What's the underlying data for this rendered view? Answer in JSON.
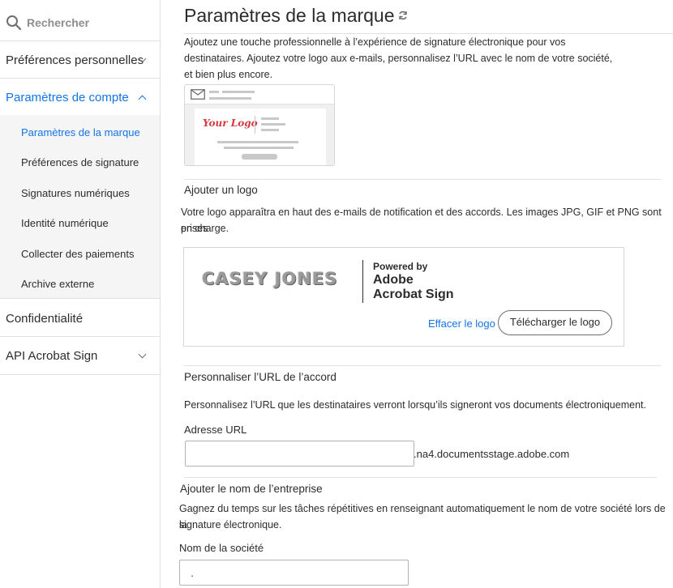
{
  "search": {
    "placeholder": "Rechercher"
  },
  "sidebar": {
    "items": [
      {
        "label": "Préférences personnelles"
      },
      {
        "label": "Paramètres de compte"
      },
      {
        "label": "Confidentialité"
      },
      {
        "label": "API Acrobat Sign"
      }
    ],
    "subitems": [
      {
        "label": "Paramètres de la marque"
      },
      {
        "label": "Préférences de signature"
      },
      {
        "label": "Signatures numériques"
      },
      {
        "label": "Identité numérique"
      },
      {
        "label": "Collecter des paiements"
      },
      {
        "label": "Archive externe"
      }
    ]
  },
  "main": {
    "title": "Paramètres de la marque",
    "intro_line1": "Ajoutez une touche professionnelle à l’expérience de signature électronique pour vos",
    "intro_line2": "destinataires. Ajoutez votre logo aux e-mails, personnalisez l’URL avec le nom de votre société,",
    "intro_line3": "et bien plus encore.",
    "preview_logo_text": "Your Logo",
    "logo_section": {
      "heading": "Ajouter un logo",
      "desc_line1": "Votre logo apparaîtra en haut des e-mails de notification et des accords. Les images JPG, GIF et PNG sont prises",
      "desc_line2": "en charge.",
      "current_logo_text": "CASEY JONES",
      "powered_by": "Powered by",
      "brand_line1": "Adobe",
      "brand_line2": "Acrobat Sign",
      "clear_link": "Effacer le logo",
      "upload_button": "Télécharger le logo"
    },
    "url_section": {
      "heading": "Personnaliser l’URL de l’accord",
      "desc": "Personnalisez l’URL que les destinataires verront lorsqu’ils signeront vos documents électroniquement.",
      "field_label": "Adresse URL",
      "field_value": "",
      "suffix": ".na4.documentsstage.adobe.com"
    },
    "company_section": {
      "heading": "Ajouter le nom de l’entreprise",
      "desc_line1": "Gagnez du temps sur les tâches répétitives en renseignant automatiquement le nom de votre société lors de la",
      "desc_line2": "signature électronique.",
      "field_label": "Nom de la société",
      "field_value": "  ."
    }
  },
  "colors": {
    "accent": "#1473e6",
    "logo_red": "#d7373f"
  }
}
